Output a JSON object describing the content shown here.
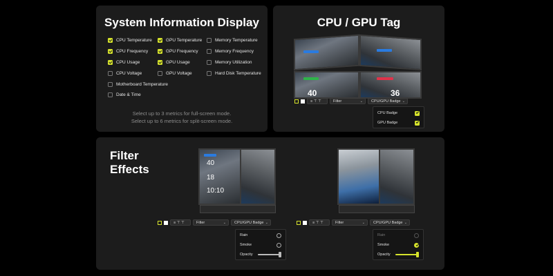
{
  "system_info": {
    "title": "System Information Display",
    "items": [
      {
        "label": "CPU Temperature",
        "checked": true
      },
      {
        "label": "GPU Temperature",
        "checked": true
      },
      {
        "label": "Memory Temperature",
        "checked": false
      },
      {
        "label": "CPU Frequency",
        "checked": true
      },
      {
        "label": "GPU Frequency",
        "checked": true
      },
      {
        "label": "Memory Frequency",
        "checked": false
      },
      {
        "label": "CPU Usage",
        "checked": true
      },
      {
        "label": "GPU Usage",
        "checked": true
      },
      {
        "label": "Memory Utilization",
        "checked": false
      },
      {
        "label": "CPU Voltage",
        "checked": false
      },
      {
        "label": "GPU Voltage",
        "checked": false
      },
      {
        "label": "Hard Disk Temperature",
        "checked": false
      },
      {
        "label": "Motherboard Temperature",
        "checked": false
      },
      {
        "label": "Date & Time",
        "checked": false
      }
    ],
    "note_line1": "Select up to 3 metrics for full-screen mode.",
    "note_line2": "Select up to 6 metrics for split-screen mode."
  },
  "cpu_gpu_tag": {
    "title": "CPU / GPU Tag",
    "screen_numbers": {
      "left": "40",
      "right": "36"
    },
    "toolbar": {
      "filter_label": "Filter",
      "badge_label": "CPU/GPU Badge"
    },
    "dropdown": [
      {
        "label": "CPU Badge",
        "checked": true
      },
      {
        "label": "GPU Badge",
        "checked": true
      }
    ]
  },
  "filter_effects": {
    "title_line1": "Filter",
    "title_line2": "Effects",
    "device_a": {
      "numbers": [
        "40",
        "18",
        "10:10"
      ],
      "toolbar": {
        "filter_label": "Filter",
        "badge_label": "CPU/GPU Badge"
      },
      "dropdown": {
        "rain": {
          "label": "Rain",
          "checked": false
        },
        "smoke": {
          "label": "Smoke",
          "checked": false
        },
        "opacity": {
          "label": "Opacity",
          "value": 1.0
        }
      }
    },
    "device_b": {
      "toolbar": {
        "filter_label": "Filter",
        "badge_label": "CPU/GPU Badge"
      },
      "dropdown": {
        "rain": {
          "label": "Rain",
          "checked": false
        },
        "smoke": {
          "label": "Smoke",
          "checked": true
        },
        "opacity": {
          "label": "Opacity",
          "value": 1.0
        }
      }
    }
  },
  "colors": {
    "accent": "#d6e32c",
    "panel": "#1c1c1c",
    "background": "#000000"
  }
}
